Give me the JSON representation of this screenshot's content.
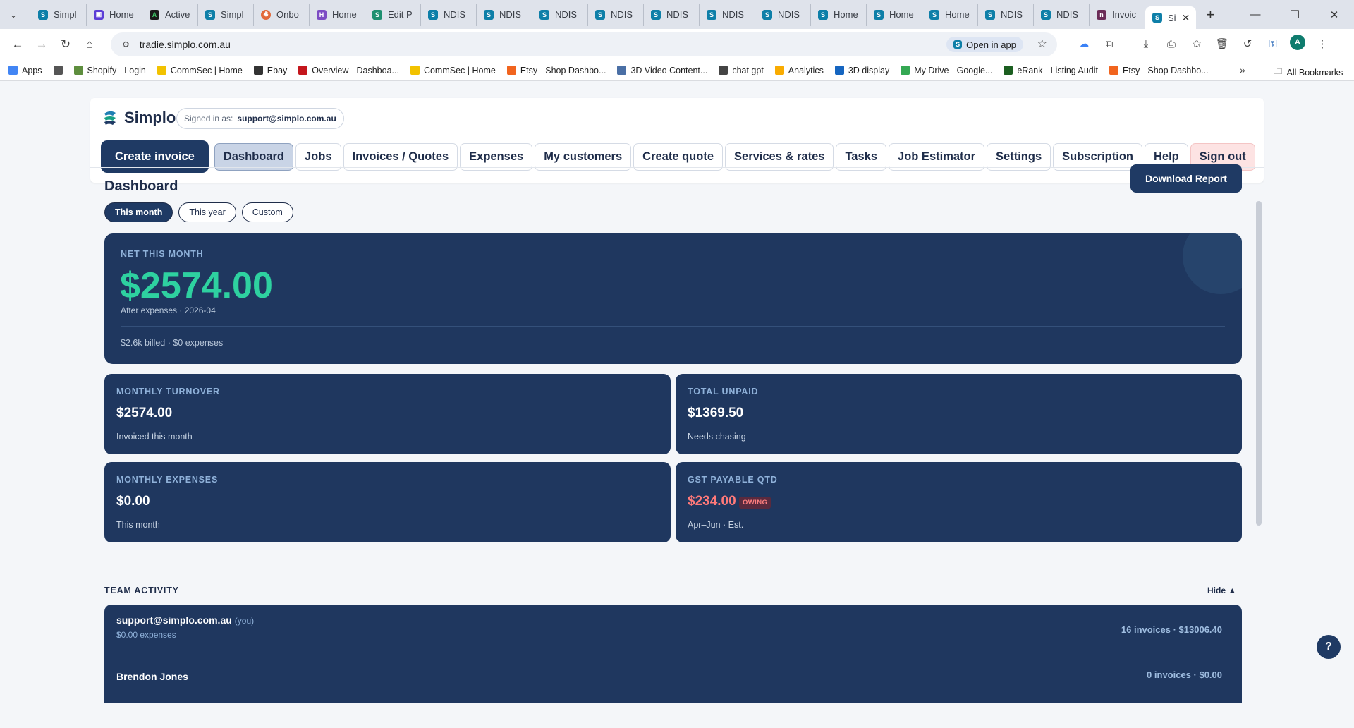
{
  "browser": {
    "tabs": [
      {
        "label": "Simpl",
        "icon": "simplo"
      },
      {
        "label": "Home",
        "icon": "purple"
      },
      {
        "label": "Active",
        "icon": "a"
      },
      {
        "label": "Simpl",
        "icon": "simplo"
      },
      {
        "label": "Onbo",
        "icon": "orange"
      },
      {
        "label": "Home",
        "icon": "h"
      },
      {
        "label": "Edit P",
        "icon": "green"
      },
      {
        "label": "NDIS",
        "icon": "simplo"
      },
      {
        "label": "NDIS",
        "icon": "simplo"
      },
      {
        "label": "NDIS",
        "icon": "simplo"
      },
      {
        "label": "NDIS",
        "icon": "simplo"
      },
      {
        "label": "NDIS",
        "icon": "simplo"
      },
      {
        "label": "NDIS",
        "icon": "simplo"
      },
      {
        "label": "NDIS",
        "icon": "simplo"
      },
      {
        "label": "Home",
        "icon": "simplo"
      },
      {
        "label": "Home",
        "icon": "simplo"
      },
      {
        "label": "Home",
        "icon": "simplo"
      },
      {
        "label": "NDIS",
        "icon": "simplo"
      },
      {
        "label": "NDIS",
        "icon": "simplo"
      },
      {
        "label": "Invoic",
        "icon": "n"
      }
    ],
    "active_tab": {
      "label": "Si",
      "icon": "simplo"
    },
    "url": "tradie.simplo.com.au",
    "open_in_app": "Open in app",
    "avatar_letter": "A",
    "bookmarks": [
      {
        "label": "Apps",
        "color": "#4285f4"
      },
      {
        "label": "",
        "color": "#555"
      },
      {
        "label": "Shopify - Login",
        "color": "#5e8e3e"
      },
      {
        "label": "CommSec | Home",
        "color": "#f2c200"
      },
      {
        "label": "Ebay",
        "color": "#333"
      },
      {
        "label": "Overview - Dashboa...",
        "color": "#c4161c"
      },
      {
        "label": "CommSec | Home",
        "color": "#f2c200"
      },
      {
        "label": "Etsy - Shop Dashbo...",
        "color": "#f1641e"
      },
      {
        "label": "3D Video Content...",
        "color": "#4a6fa5"
      },
      {
        "label": "chat gpt",
        "color": "#444"
      },
      {
        "label": "Analytics",
        "color": "#f9ab00"
      },
      {
        "label": "3D display",
        "color": "#1565c0"
      },
      {
        "label": "My Drive - Google...",
        "color": "#34a853"
      },
      {
        "label": "eRank - Listing Audit",
        "color": "#1b5e20"
      },
      {
        "label": "Etsy - Shop Dashbo...",
        "color": "#f1641e"
      }
    ],
    "bookmarks_more": "»",
    "all_bookmarks": "All Bookmarks"
  },
  "app": {
    "brand": "Simplo",
    "signed_in_label": "Signed in as:",
    "signed_in_email": "support@simplo.com.au",
    "create_invoice": "Create invoice",
    "nav": [
      {
        "label": "Dashboard",
        "active": true
      },
      {
        "label": "Jobs"
      },
      {
        "label": "Invoices / Quotes"
      },
      {
        "label": "Expenses"
      },
      {
        "label": "My customers"
      },
      {
        "label": "Create quote"
      },
      {
        "label": "Services & rates"
      },
      {
        "label": "Tasks"
      },
      {
        "label": "Job Estimator"
      },
      {
        "label": "Settings"
      },
      {
        "label": "Subscription"
      },
      {
        "label": "Help"
      },
      {
        "label": "Sign out",
        "signout": true
      }
    ]
  },
  "dashboard": {
    "title": "Dashboard",
    "download_report": "Download Report",
    "periods": [
      "This month",
      "This year",
      "Custom"
    ],
    "active_period": "This month",
    "net": {
      "label": "NET THIS MONTH",
      "value": "$2574.00",
      "sub": "After expenses · 2026-04",
      "foot": "$2.6k billed · $0 expenses"
    },
    "stats": [
      {
        "label": "MONTHLY TURNOVER",
        "value": "$2574.00",
        "sub": "Invoiced this month"
      },
      {
        "label": "TOTAL UNPAID",
        "value": "$1369.50",
        "sub": "Needs chasing"
      },
      {
        "label": "MONTHLY EXPENSES",
        "value": "$0.00",
        "sub": "This month"
      },
      {
        "label": "GST PAYABLE QTD",
        "value": "$234.00",
        "sub": "Apr–Jun · Est.",
        "badge": "OWING"
      }
    ],
    "team": {
      "heading": "TEAM ACTIVITY",
      "hide": "Hide ▲",
      "members": [
        {
          "name": "support@simplo.com.au",
          "you": "(you)",
          "expenses": "$0.00 expenses",
          "summary": "16 invoices · $13006.40"
        },
        {
          "name": "Brendon Jones",
          "summary": "0 invoices · $0.00"
        }
      ]
    },
    "help_fab": "?"
  }
}
